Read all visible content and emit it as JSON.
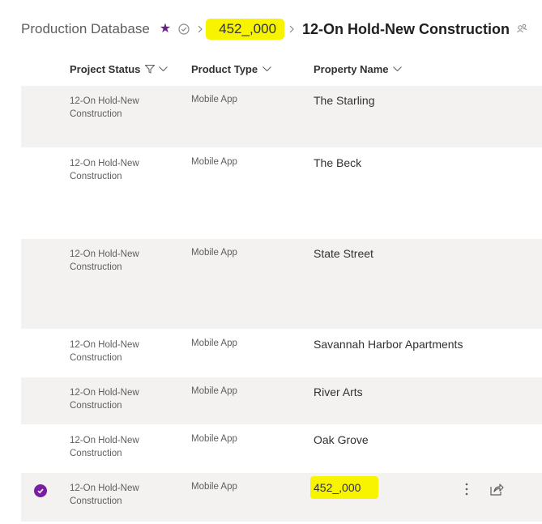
{
  "breadcrumb": {
    "database": "Production Database",
    "record_id": "452_,000",
    "current": "12-On Hold-New Construction"
  },
  "columns": [
    {
      "label": "Project Status",
      "filtered": true
    },
    {
      "label": "Product Type",
      "filtered": false
    },
    {
      "label": "Property Name",
      "filtered": false
    }
  ],
  "rows": [
    {
      "status_line1": "12-On Hold-New",
      "status_line2": "Construction",
      "type": "Mobile App",
      "name": "The Starling",
      "selected": false
    },
    {
      "status_line1": "12-On Hold-New",
      "status_line2": "Construction",
      "type": "Mobile App",
      "name": "The Beck",
      "selected": false
    },
    {
      "status_line1": "12-On Hold-New",
      "status_line2": "Construction",
      "type": "Mobile App",
      "name": "State Street",
      "selected": false
    },
    {
      "status_line1": "12-On Hold-New",
      "status_line2": "Construction",
      "type": "Mobile App",
      "name": "Savannah Harbor Apartments",
      "selected": false
    },
    {
      "status_line1": "12-On Hold-New",
      "status_line2": "Construction",
      "type": "Mobile App",
      "name": "River Arts",
      "selected": false
    },
    {
      "status_line1": "12-On Hold-New",
      "status_line2": "Construction",
      "type": "Mobile App",
      "name": "Oak Grove",
      "selected": false
    },
    {
      "status_line1": "12-On Hold-New",
      "status_line2": "Construction",
      "type": "Mobile App",
      "name": "452_,000",
      "selected": true
    }
  ],
  "icons": {
    "favorite": "star-icon",
    "status": "check-circle-icon",
    "separator": "chevron-right-icon",
    "people": "people-icon",
    "filter": "filter-icon",
    "sort": "chevron-down-icon",
    "selected": "checkmark-circle-icon",
    "more": "more-vertical-icon",
    "share": "share-icon"
  },
  "colors": {
    "accent": "#6b1f86",
    "highlight": "#f8f400",
    "row_shade": "#f3f2f1"
  }
}
